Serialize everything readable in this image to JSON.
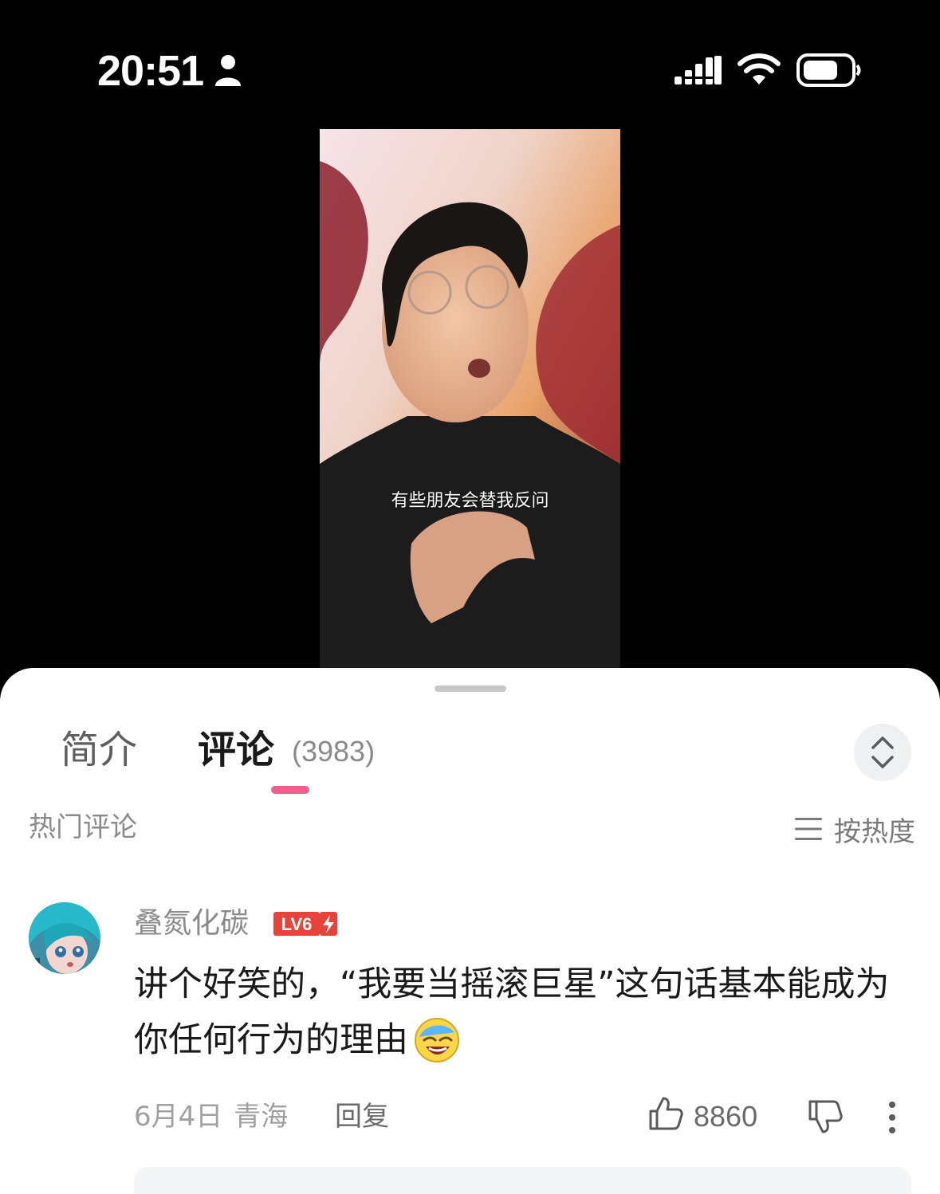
{
  "status_bar": {
    "time": "20:51",
    "icons": [
      "person-icon",
      "signal-icon",
      "wifi-icon",
      "battery-icon"
    ]
  },
  "video": {
    "subtitle": "有些朋友会替我反问"
  },
  "tabs": [
    {
      "label": "简介",
      "active": false
    },
    {
      "label": "评论",
      "active": true,
      "count": "(3983)"
    }
  ],
  "section": {
    "title": "热门评论",
    "sort_label": "按热度"
  },
  "comment": {
    "username": "叠氮化碳",
    "level": "LV6",
    "text": "讲个好笑的，“我要当摇滚巨星”这句话基本能成为你任何行为的理由",
    "date": "6月4日",
    "location": "青海",
    "reply_label": "回复",
    "like_count": "8860"
  },
  "colors": {
    "accent": "#ef5f8c",
    "level_badge": "#e8433b",
    "text_primary": "#1a1a1a",
    "text_secondary": "#8a8a8a"
  }
}
